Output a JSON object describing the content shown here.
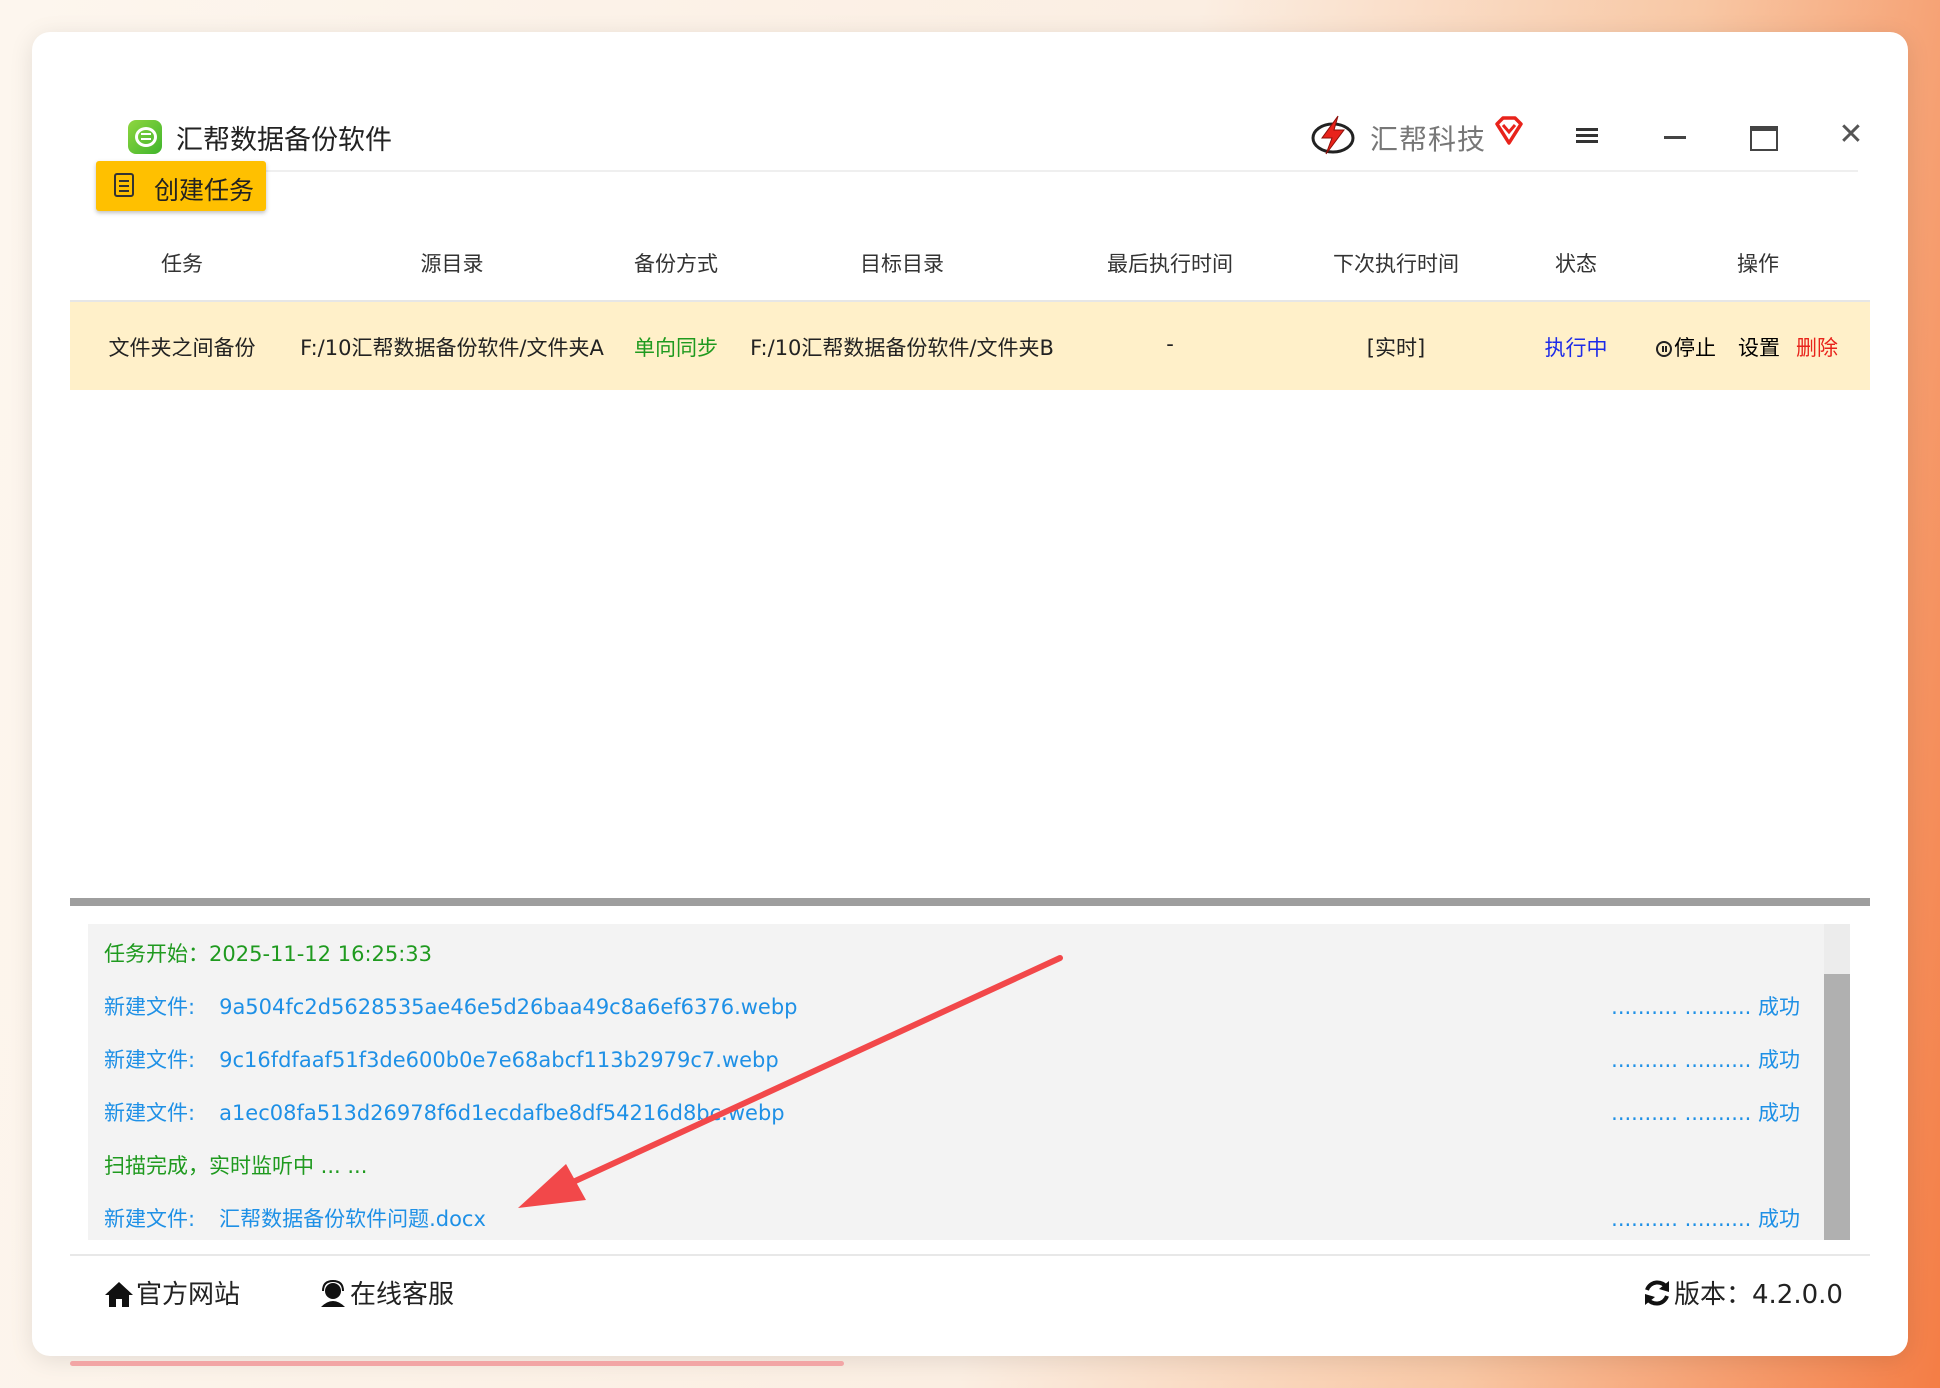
{
  "app": {
    "title": "汇帮数据备份软件",
    "brand": "汇帮科技"
  },
  "toolbar": {
    "create_task": "创建任务"
  },
  "table": {
    "headers": [
      "任务",
      "源目录",
      "备份方式",
      "目标目录",
      "最后执行时间",
      "下次执行时间",
      "状态",
      "操作"
    ],
    "rows": [
      {
        "task": "文件夹之间备份",
        "source": "F:/10汇帮数据备份软件/文件夹A",
        "mode": "单向同步",
        "target": "F:/10汇帮数据备份软件/文件夹B",
        "last_run": "-",
        "next_run": "[实时]",
        "status": "执行中",
        "actions": {
          "stop": "停止",
          "settings": "设置",
          "delete": "删除"
        }
      }
    ]
  },
  "log": [
    {
      "type": "info",
      "text": "任务开始：2025-11-12 16:25:33"
    },
    {
      "type": "file",
      "label": "新建文件:",
      "name": "9a504fc2d5628535ae46e5d26baa49c8a6ef6376.webp",
      "result": ".......... .......... 成功"
    },
    {
      "type": "file",
      "label": "新建文件:",
      "name": "9c16fdfaaf51f3de600b0e7e68abcf113b2979c7.webp",
      "result": ".......... .......... 成功"
    },
    {
      "type": "file",
      "label": "新建文件:",
      "name": "a1ec08fa513d26978f6d1ecdafbe8df54216d8bc.webp",
      "result": ".......... .......... 成功"
    },
    {
      "type": "info",
      "text": "扫描完成，实时监听中 ... ..."
    },
    {
      "type": "file",
      "label": "新建文件:",
      "name": "汇帮数据备份软件问题.docx",
      "result": ".......... .......... 成功"
    }
  ],
  "footer": {
    "website": "官方网站",
    "support": "在线客服",
    "version": "版本：4.2.0.0"
  },
  "colors": {
    "accent": "#ffc000",
    "row_highlight": "#fff0c9",
    "success": "#1f9a1f",
    "link": "#1e90e6",
    "danger": "#e8231b",
    "running": "#1d2be8",
    "arrow": "#f2484a"
  }
}
